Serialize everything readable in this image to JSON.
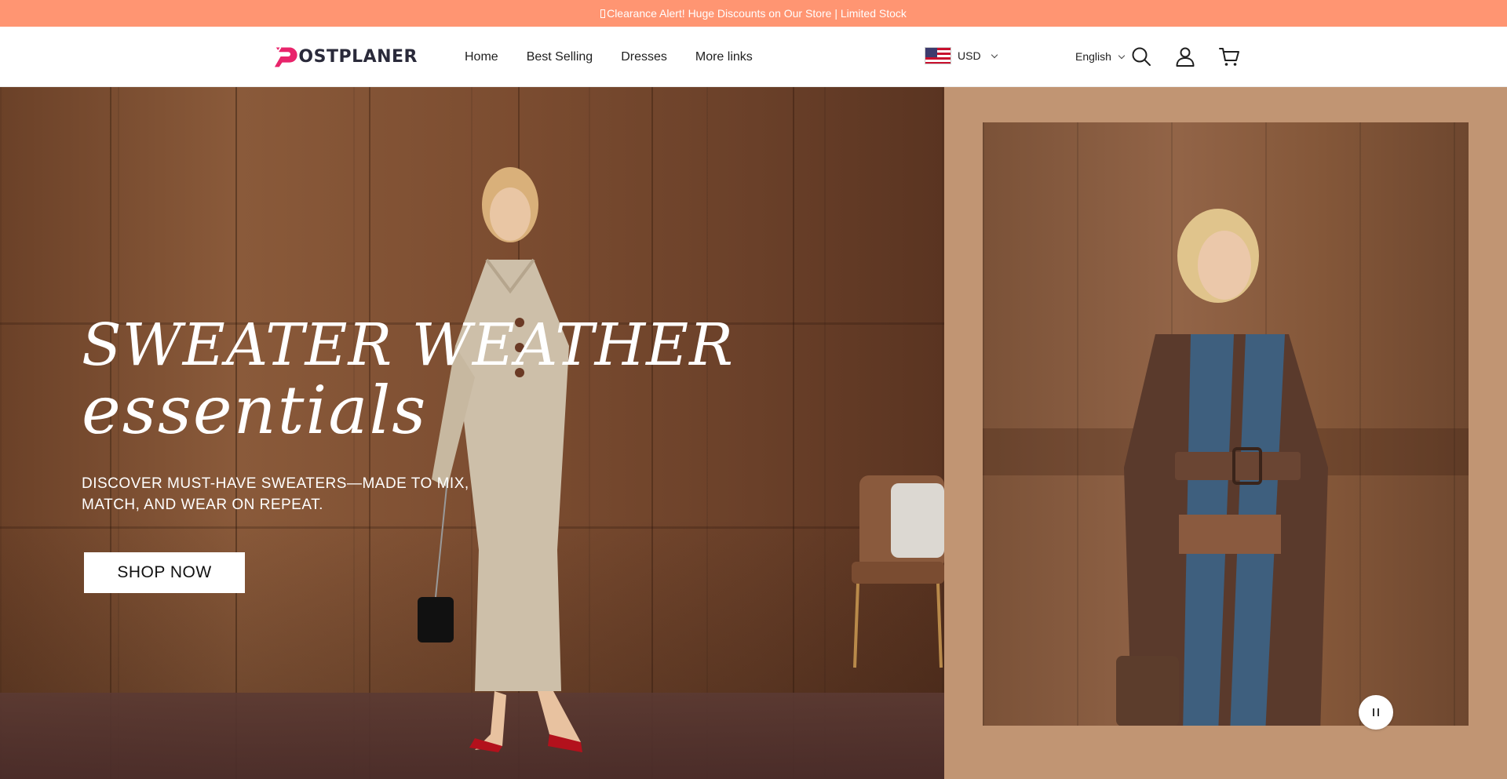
{
  "announcement": {
    "text": "Clearance Alert! Huge Discounts on Our Store | Limited Stock"
  },
  "header": {
    "logo_text": "OSTPLANER",
    "nav": [
      "Home",
      "Best Selling",
      "Dresses",
      "More links"
    ],
    "currency": {
      "code": "USD"
    },
    "language": "English",
    "icons": [
      "search-icon",
      "account-icon",
      "cart-icon"
    ]
  },
  "hero": {
    "title_line1": "SWEATER WEATHER",
    "title_line2": "essentials",
    "subtitle": "DISCOVER MUST-HAVE SWEATERS—MADE TO MIX, MATCH, AND WEAR ON REPEAT.",
    "cta_label": "SHOP NOW"
  },
  "slideshow": {
    "control": "pause"
  },
  "colors": {
    "announcement_bg": "#ff9572",
    "brand_logo": "#e8246b",
    "right_panel_bg": "#c19573",
    "text_dark": "#1f1f1f"
  }
}
